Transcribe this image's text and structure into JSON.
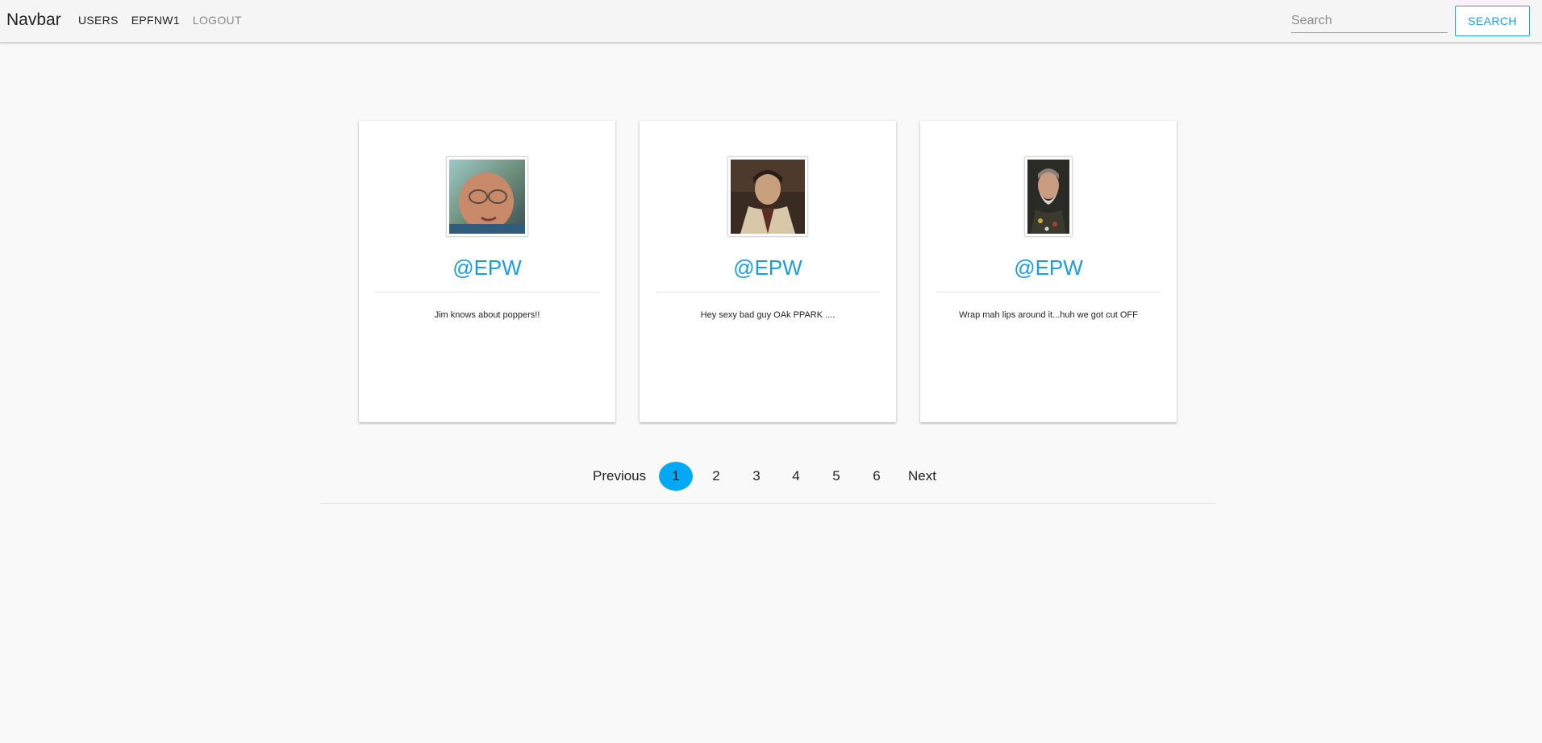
{
  "navbar": {
    "brand": "Navbar",
    "links": [
      "USERS",
      "EPFNW1",
      "LOGOUT"
    ],
    "search_placeholder": "Search",
    "search_button": "SEARCH"
  },
  "cards": [
    {
      "handle": "@EPW",
      "message": "Jim knows about poppers!!"
    },
    {
      "handle": "@EPW",
      "message": "Hey sexy bad guy OAk PPARK ...."
    },
    {
      "handle": "@EPW",
      "message": "Wrap mah lips around it...huh we got cut OFF"
    }
  ],
  "pagination": {
    "previous": "Previous",
    "pages": [
      "1",
      "2",
      "3",
      "4",
      "5",
      "6"
    ],
    "active_page": "1",
    "next": "Next"
  },
  "colors": {
    "accent": "#03a9f4",
    "link_blue": "#1a9ce0",
    "background": "#f9f9f9"
  }
}
